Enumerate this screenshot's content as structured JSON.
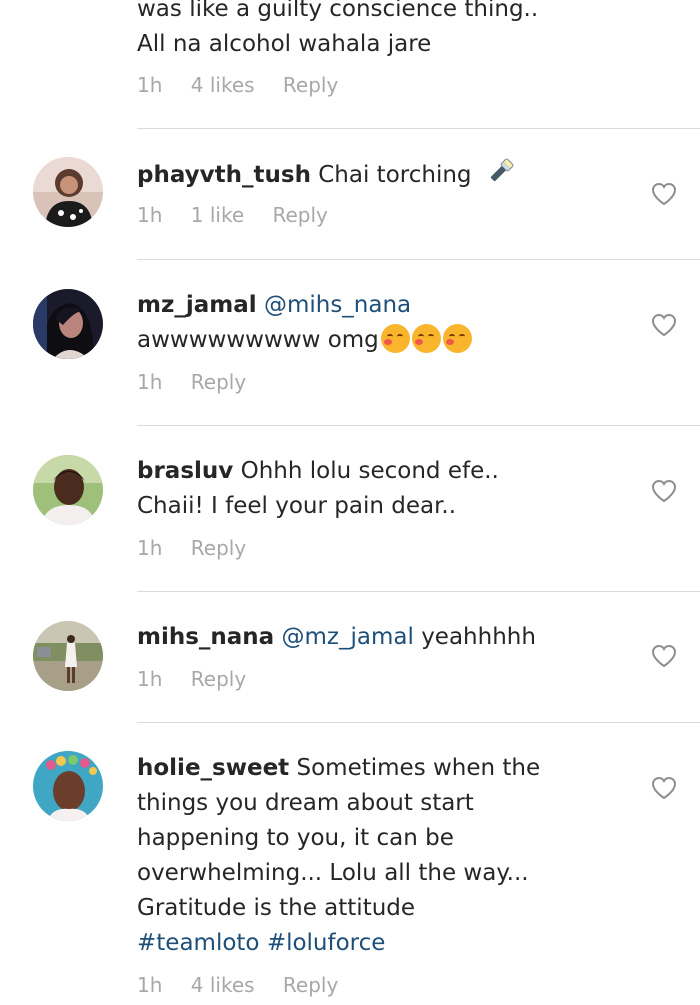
{
  "top_comment": {
    "lines": [
      "was like a guilty conscience thing..",
      "All na alcohol wahala jare"
    ],
    "time": "1h",
    "likes": "4 likes",
    "reply": "Reply"
  },
  "comments": [
    {
      "username": "phayvth_tush",
      "text": "Chai torching",
      "time": "1h",
      "likes": "1 like",
      "reply": "Reply"
    },
    {
      "username": "mz_jamal",
      "mention": "@mihs_nana",
      "text": "awwwwwwwww  omg",
      "time": "1h",
      "reply": "Reply"
    },
    {
      "username": "brasluv",
      "text_line1": "Ohhh lolu second efe..",
      "text_line2": "Chaii!  I feel your pain dear..",
      "time": "1h",
      "reply": "Reply"
    },
    {
      "username": "mihs_nana",
      "mention": "@mz_jamal",
      "text": "yeahhhhh",
      "time": "1h",
      "reply": "Reply"
    },
    {
      "username": "holie_sweet",
      "text_line1": "Sometimes when the",
      "text_line2": "things you dream about start",
      "text_line3": "happening to you, it can be",
      "text_line4": "overwhelming... Lolu all the way...",
      "text_line5": "Gratitude is the attitude",
      "hashtag1": "#teamloto",
      "hashtag2": "#loluforce",
      "time": "1h",
      "likes": "4 likes",
      "reply": "Reply"
    }
  ],
  "icons": {
    "like": "heart-outline-icon",
    "torch": "flashlight-emoji",
    "emoji": "blushing-face-emoji"
  },
  "colors": {
    "mention": "#1d4f79",
    "meta": "#a8a8a8",
    "text": "#262626",
    "divider": "#dbdbdb"
  }
}
